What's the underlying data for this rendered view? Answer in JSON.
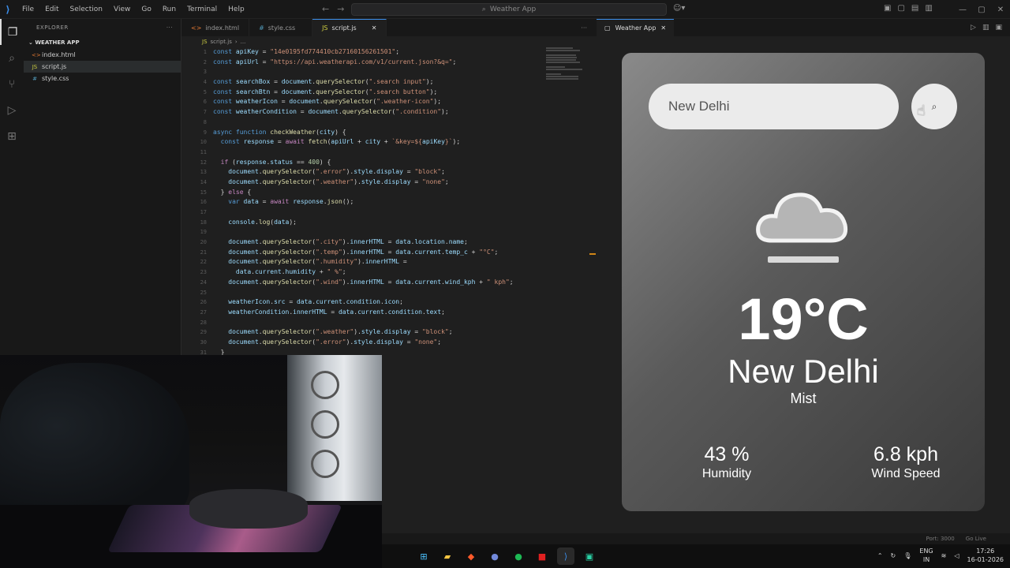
{
  "titlebar": {
    "menu": [
      "File",
      "Edit",
      "Selection",
      "View",
      "Go",
      "Run",
      "Terminal",
      "Help"
    ],
    "search": "Weather App"
  },
  "sidebar": {
    "header": "EXPLORER",
    "folder": "WEATHER APP",
    "files": [
      {
        "name": "index.html",
        "icon": "<>",
        "color": "#e37933"
      },
      {
        "name": "script.js",
        "icon": "JS",
        "color": "#cbcb41"
      },
      {
        "name": "style.css",
        "icon": "#",
        "color": "#519aba"
      }
    ]
  },
  "editor": {
    "tabs": [
      {
        "name": "index.html",
        "icon": "<>",
        "color": "#e37933"
      },
      {
        "name": "style.css",
        "icon": "#",
        "color": "#519aba"
      },
      {
        "name": "script.js",
        "icon": "JS",
        "color": "#cbcb41"
      }
    ],
    "breadcrumb": [
      "script.js",
      "..."
    ],
    "visible_fragment": "> {"
  },
  "preview": {
    "tab": "Weather App",
    "search_value": "New Delhi",
    "temp": "19°C",
    "city": "New Delhi",
    "condition": "Mist",
    "humidity_value": "43 %",
    "humidity_label": "Humidity",
    "wind_value": "6.8 kph",
    "wind_label": "Wind Speed"
  },
  "statusbar": [
    "Port: 3000",
    "Go Live"
  ],
  "taskbar": {
    "lang": "ENG",
    "region": "IN",
    "time": "17:26",
    "date": "16-01-2026"
  }
}
